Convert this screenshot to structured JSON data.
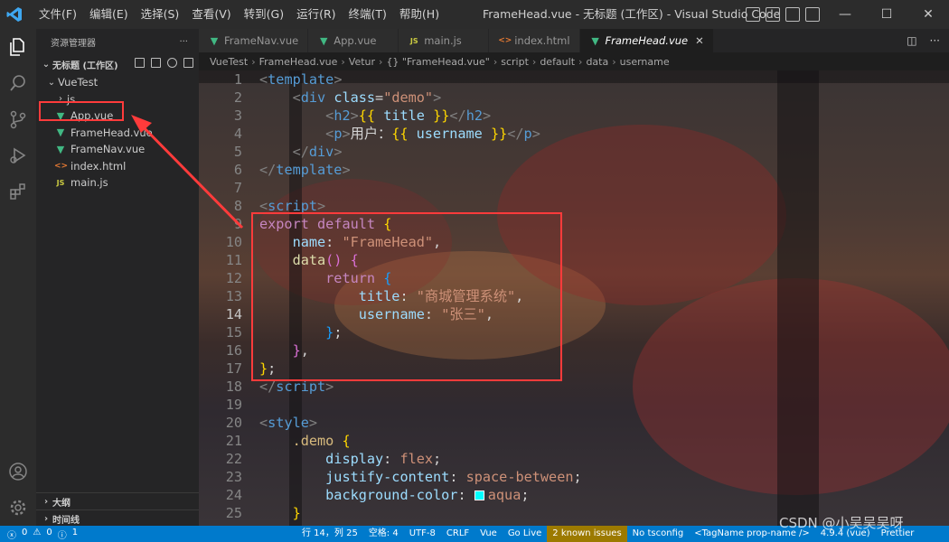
{
  "titlebar": {
    "menus": [
      "文件(F)",
      "编辑(E)",
      "选择(S)",
      "查看(V)",
      "转到(G)",
      "运行(R)",
      "终端(T)",
      "帮助(H)"
    ],
    "title": "FrameHead.vue - 无标题 (工作区) - Visual Studio Code"
  },
  "sidebar": {
    "header": "资源管理器",
    "more": "···",
    "workspace": "无标题 (工作区)",
    "tree": [
      {
        "label": "VueTest",
        "kind": "folder-open",
        "depth": 1
      },
      {
        "label": "js",
        "kind": "folder-closed",
        "depth": 2
      },
      {
        "label": "App.vue",
        "kind": "vue",
        "depth": 2
      },
      {
        "label": "FrameHead.vue",
        "kind": "vue",
        "depth": 2
      },
      {
        "label": "FrameNav.vue",
        "kind": "vue",
        "depth": 2
      },
      {
        "label": "index.html",
        "kind": "html",
        "depth": 2
      },
      {
        "label": "main.js",
        "kind": "js",
        "depth": 2
      }
    ],
    "outline": "大纲",
    "timeline": "时间线"
  },
  "tabs": [
    {
      "label": "FrameNav.vue",
      "kind": "vue",
      "active": false
    },
    {
      "label": "App.vue",
      "kind": "vue",
      "active": false
    },
    {
      "label": "main.js",
      "kind": "js",
      "active": false
    },
    {
      "label": "index.html",
      "kind": "html",
      "active": false
    },
    {
      "label": "FrameHead.vue",
      "kind": "vue",
      "active": true
    }
  ],
  "breadcrumbs": [
    "VueTest",
    "FrameHead.vue",
    "Vetur",
    "{} \"FrameHead.vue\"",
    "script",
    "default",
    "data",
    "username"
  ],
  "editor": {
    "current_line": 14,
    "lines": [
      [
        [
          "t-tag",
          "<"
        ],
        [
          "t-tagname",
          "template"
        ],
        [
          "t-tag",
          ">"
        ]
      ],
      [
        [
          "t-text",
          "    "
        ],
        [
          "t-tag",
          "<"
        ],
        [
          "t-tagname",
          "div"
        ],
        [
          "t-text",
          " "
        ],
        [
          "t-attr",
          "class"
        ],
        [
          "t-text",
          "="
        ],
        [
          "t-str",
          "\"demo\""
        ],
        [
          "t-tag",
          ">"
        ]
      ],
      [
        [
          "t-text",
          "        "
        ],
        [
          "t-tag",
          "<"
        ],
        [
          "t-tagname",
          "h2"
        ],
        [
          "t-tag",
          ">"
        ],
        [
          "t-brace",
          "{{"
        ],
        [
          "t-text",
          " "
        ],
        [
          "t-var",
          "title"
        ],
        [
          "t-text",
          " "
        ],
        [
          "t-brace",
          "}}"
        ],
        [
          "t-tag",
          "</"
        ],
        [
          "t-tagname",
          "h2"
        ],
        [
          "t-tag",
          ">"
        ]
      ],
      [
        [
          "t-text",
          "        "
        ],
        [
          "t-tag",
          "<"
        ],
        [
          "t-tagname",
          "p"
        ],
        [
          "t-tag",
          ">"
        ],
        [
          "t-text",
          "用户："
        ],
        [
          "t-brace",
          "{{"
        ],
        [
          "t-text",
          " "
        ],
        [
          "t-var",
          "username"
        ],
        [
          "t-text",
          " "
        ],
        [
          "t-brace",
          "}}"
        ],
        [
          "t-tag",
          "</"
        ],
        [
          "t-tagname",
          "p"
        ],
        [
          "t-tag",
          ">"
        ]
      ],
      [
        [
          "t-text",
          "    "
        ],
        [
          "t-tag",
          "</"
        ],
        [
          "t-tagname",
          "div"
        ],
        [
          "t-tag",
          ">"
        ]
      ],
      [
        [
          "t-tag",
          "</"
        ],
        [
          "t-tagname",
          "template"
        ],
        [
          "t-tag",
          ">"
        ]
      ],
      [],
      [
        [
          "t-tag",
          "<"
        ],
        [
          "t-tagname",
          "script"
        ],
        [
          "t-tag",
          ">"
        ]
      ],
      [
        [
          "t-kw",
          "export"
        ],
        [
          "t-text",
          " "
        ],
        [
          "t-kw",
          "default"
        ],
        [
          "t-text",
          " "
        ],
        [
          "t-brace",
          "{"
        ]
      ],
      [
        [
          "t-text",
          "    "
        ],
        [
          "t-prop",
          "name"
        ],
        [
          "t-text",
          ": "
        ],
        [
          "t-str",
          "\"FrameHead\""
        ],
        [
          "t-text",
          ","
        ]
      ],
      [
        [
          "t-text",
          "    "
        ],
        [
          "t-fn",
          "data"
        ],
        [
          "t-brace2",
          "()"
        ],
        [
          "t-text",
          " "
        ],
        [
          "t-brace2",
          "{"
        ]
      ],
      [
        [
          "t-text",
          "        "
        ],
        [
          "t-kw",
          "return"
        ],
        [
          "t-text",
          " "
        ],
        [
          "t-brace3",
          "{"
        ]
      ],
      [
        [
          "t-text",
          "            "
        ],
        [
          "t-prop",
          "title"
        ],
        [
          "t-text",
          ": "
        ],
        [
          "t-str",
          "\"商城管理系统\""
        ],
        [
          "t-text",
          ","
        ]
      ],
      [
        [
          "t-text",
          "            "
        ],
        [
          "t-prop",
          "username"
        ],
        [
          "t-text",
          ": "
        ],
        [
          "t-str",
          "\"张三\""
        ],
        [
          "t-text",
          ","
        ]
      ],
      [
        [
          "t-text",
          "        "
        ],
        [
          "t-brace3",
          "}"
        ],
        [
          "t-text",
          ";"
        ]
      ],
      [
        [
          "t-text",
          "    "
        ],
        [
          "t-brace2",
          "}"
        ],
        [
          "t-text",
          ","
        ]
      ],
      [
        [
          "t-brace",
          "}"
        ],
        [
          "t-text",
          ";"
        ]
      ],
      [
        [
          "t-tag",
          "</"
        ],
        [
          "t-tagname",
          "script"
        ],
        [
          "t-tag",
          ">"
        ]
      ],
      [],
      [
        [
          "t-tag",
          "<"
        ],
        [
          "t-tagname",
          "style"
        ],
        [
          "t-tag",
          ">"
        ]
      ],
      [
        [
          "t-text",
          "    "
        ],
        [
          "t-cls",
          ".demo"
        ],
        [
          "t-text",
          " "
        ],
        [
          "t-brace",
          "{"
        ]
      ],
      [
        [
          "t-text",
          "        "
        ],
        [
          "t-prop",
          "display"
        ],
        [
          "t-text",
          ": "
        ],
        [
          "t-str",
          "flex"
        ],
        [
          "t-text",
          ";"
        ]
      ],
      [
        [
          "t-text",
          "        "
        ],
        [
          "t-prop",
          "justify-content"
        ],
        [
          "t-text",
          ": "
        ],
        [
          "t-str",
          "space-between"
        ],
        [
          "t-text",
          ";"
        ]
      ],
      [
        [
          "t-text",
          "        "
        ],
        [
          "t-prop",
          "background-color"
        ],
        [
          "t-text",
          ": "
        ],
        [
          "swatch",
          ""
        ],
        [
          "t-str",
          "aqua"
        ],
        [
          "t-text",
          ";"
        ]
      ],
      [
        [
          "t-text",
          "    "
        ],
        [
          "t-brace",
          "}"
        ]
      ]
    ]
  },
  "statusbar": {
    "errors": "0",
    "warnings": "0",
    "info": "1",
    "items": [
      "行 14，列 25",
      "空格: 4",
      "UTF-8",
      "CRLF",
      "Vue",
      "Go Live",
      "2 known issues",
      "No tsconfig",
      "<TagName prop-name />",
      "4.9.4 (vue)",
      "Prettier"
    ]
  },
  "watermark": "CSDN @小吴吴吴呀"
}
